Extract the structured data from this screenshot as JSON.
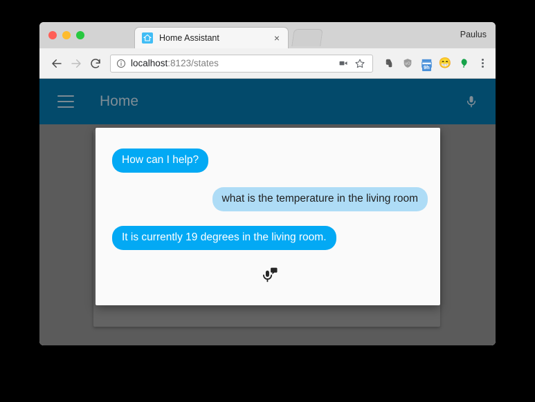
{
  "window": {
    "traffic_lights": [
      {
        "name": "close",
        "color": "#ff5f57"
      },
      {
        "name": "minimize",
        "color": "#febc2e"
      },
      {
        "name": "zoom",
        "color": "#28c840"
      }
    ],
    "profile_name": "Paulus"
  },
  "tab": {
    "title": "Home Assistant",
    "favicon_name": "home-assistant-house-icon",
    "close_label": "×",
    "new_tab_label": "+"
  },
  "toolbar": {
    "back_icon": "back-arrow-icon",
    "forward_icon": "forward-arrow-icon",
    "reload_icon": "reload-icon",
    "security_icon": "info-circle-icon",
    "url_host": "localhost",
    "url_rest": ":8123/states",
    "url_full": "localhost:8123/states",
    "cast_icon": "cast-video-icon",
    "bookmark_icon": "star-icon",
    "extensions": [
      {
        "name": "evernote-extension-icon",
        "glyph": "🐘",
        "color": "#5a5a5a"
      },
      {
        "name": "ublock-shield-extension-icon",
        "glyph": "🛡",
        "color": "#8a8a8a"
      },
      {
        "name": "timer-9h-extension-icon",
        "glyph": "",
        "badge": "9h",
        "color": "#4a90d9"
      },
      {
        "name": "emoji-smiley-extension-icon",
        "glyph": "😁",
        "color": "#f5c518"
      },
      {
        "name": "green-balloon-extension-icon",
        "glyph": "",
        "color": "#16a34a"
      }
    ],
    "menu_icon": "three-dot-menu-icon"
  },
  "app": {
    "menu_icon": "hamburger-menu-icon",
    "title": "Home",
    "mic_icon": "microphone-icon",
    "header_color": "#034a6b",
    "title_color": "#7f8d96"
  },
  "conversation": {
    "messages": [
      {
        "sender": "system",
        "text": "How can I help?"
      },
      {
        "sender": "user",
        "text": "what is the temperature in the living room"
      },
      {
        "sender": "system",
        "text": "It is currently 19 degrees in the living room."
      }
    ],
    "listen_icon": "microphone-chat-icon",
    "system_bubble_color": "#03a9f4",
    "user_bubble_color": "#aedcf6"
  }
}
